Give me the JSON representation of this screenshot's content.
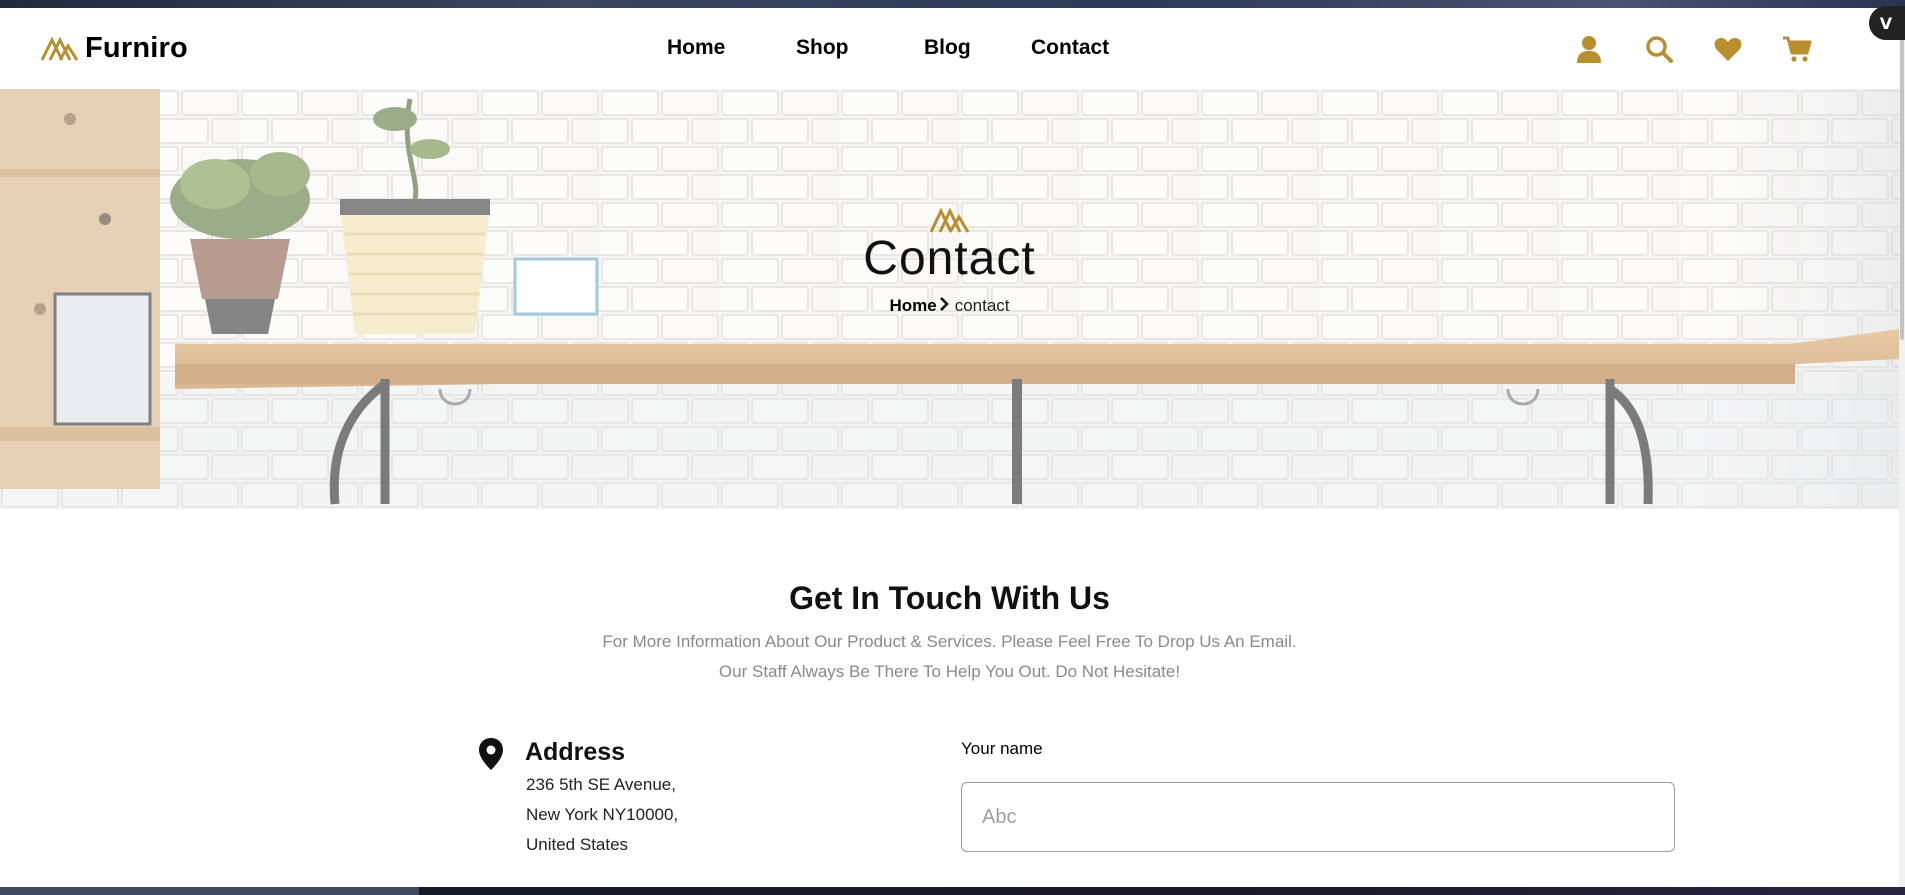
{
  "brand": {
    "name": "Furniro",
    "accent": "#B88E2F"
  },
  "nav": {
    "items": [
      {
        "label": "Home"
      },
      {
        "label": "Shop"
      },
      {
        "label": "Blog"
      },
      {
        "label": "Contact"
      }
    ]
  },
  "header_icons": [
    "user-icon",
    "search-icon",
    "heart-icon",
    "cart-icon"
  ],
  "hero": {
    "title": "Contact",
    "breadcrumb": {
      "home": "Home",
      "separator_icon": "chevron-right-icon",
      "current": "contact"
    }
  },
  "contact": {
    "title": "Get In Touch With Us",
    "subtitle_line1": "For More Information About Our Product & Services. Please Feel Free To Drop Us An Email.",
    "subtitle_line2": "Our Staff Always Be There To Help You Out. Do Not Hesitate!",
    "address": {
      "icon": "map-pin-icon",
      "title": "Address",
      "line1": "236 5th SE Avenue,",
      "line2": "New York NY10000,",
      "line3": "United States"
    },
    "form": {
      "name_label": "Your name",
      "name_placeholder": "Abc"
    }
  },
  "extension_badge": {
    "label": "V"
  }
}
